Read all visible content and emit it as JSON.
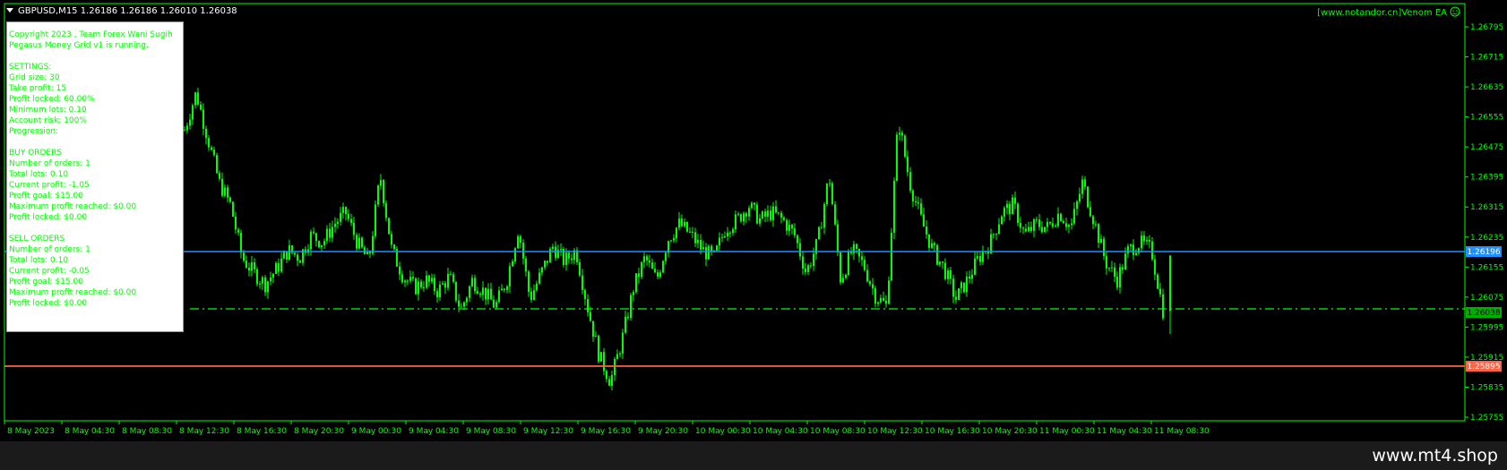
{
  "header": {
    "symbol_line": "GBPUSD,M15  1.26186 1.26186 1.26010 1.26038",
    "ea_label": "[www.notandor.cn]Venom EA",
    "ea_icon": "smiley-icon"
  },
  "info_panel": {
    "lines": [
      "Copyright 2023 , Team Forex Wani Sugih",
      "Pegasus Money Grid v1 is running.",
      "",
      "SETTINGS:",
      "Grid size: 30",
      "Take profit: 15",
      "Profit locked: 60.00%",
      "Minimum lots: 0.10",
      "Account risk: 100%",
      "Progression:",
      "",
      "BUY ORDERS",
      "Number of orders: 1",
      "Total lots: 0.10",
      "Current profit: -1.05",
      "Profit goal: $15.00",
      "Maximum profit reached: $0.00",
      "Profit locked: $0.00",
      "",
      "SELL ORDERS",
      "Number of orders: 1",
      "Total lots: 0.10",
      "Current profit: -0.05",
      "Profit goal: $15.00",
      "Maximum profit reached: $0.00",
      "Profit locked: $0.00"
    ]
  },
  "price_axis": {
    "ticks": [
      "1.26795",
      "1.26715",
      "1.26635",
      "1.26555",
      "1.26475",
      "1.26395",
      "1.26315",
      "1.26235",
      "1.26155",
      "1.26075",
      "1.25995",
      "1.25915",
      "1.25835",
      "1.25755"
    ]
  },
  "time_axis": {
    "labels": [
      "8 May 2023",
      "8 May 04:30",
      "8 May 08:30",
      "8 May 12:30",
      "8 May 16:30",
      "8 May 20:30",
      "9 May 00:30",
      "9 May 04:30",
      "9 May 08:30",
      "9 May 12:30",
      "9 May 16:30",
      "9 May 20:30",
      "10 May 00:30",
      "10 May 04:30",
      "10 May 08:30",
      "10 May 12:30",
      "10 May 16:30",
      "10 May 20:30",
      "11 May 00:30",
      "11 May 04:30",
      "11 May 08:30"
    ]
  },
  "levels": {
    "blue": {
      "price": "1.26196",
      "color": "#1e90ff"
    },
    "current": {
      "price": "1.26038",
      "color": "#00ff00"
    },
    "red": {
      "price": "1.25895",
      "color": "#ff6347"
    }
  },
  "colors": {
    "candles": "#00ff00",
    "grid_frame": "#00ff00",
    "background": "#000000"
  },
  "chart_data": {
    "type": "line",
    "x": [
      "8 May 2023",
      "8 May 04:30",
      "8 May 08:30",
      "8 May 12:30",
      "8 May 16:30",
      "8 May 20:30",
      "9 May 00:30",
      "9 May 04:30",
      "9 May 08:30",
      "9 May 12:30",
      "9 May 16:30",
      "9 May 20:30",
      "10 May 00:30",
      "10 May 04:30",
      "10 May 08:30",
      "10 May 12:30",
      "10 May 16:30",
      "10 May 20:30",
      "11 May 00:30",
      "11 May 04:30",
      "11 May 08:30"
    ],
    "series": [
      {
        "name": "GBPUSD,M15",
        "values": [
          1.2652,
          1.2662,
          1.265,
          1.2638,
          1.2632,
          1.2618,
          1.2614,
          1.2611,
          1.2615,
          1.262,
          1.2618,
          1.2624,
          1.2622,
          1.2627,
          1.263,
          1.2622,
          1.2617,
          1.264,
          1.262,
          1.2613,
          1.261,
          1.2612,
          1.2609,
          1.2613,
          1.2604,
          1.2612,
          1.2609,
          1.2605,
          1.2612,
          1.2626,
          1.2607,
          1.2614,
          1.2621,
          1.2617,
          1.262,
          1.2605,
          1.2592,
          1.2585,
          1.2596,
          1.261,
          1.2618,
          1.2612,
          1.2623,
          1.2627,
          1.2624,
          1.262,
          1.2618,
          1.2626,
          1.2628,
          1.2632,
          1.2628,
          1.263,
          1.2628,
          1.2624,
          1.2614,
          1.2622,
          1.264,
          1.2612,
          1.262,
          1.2616,
          1.2608,
          1.2605,
          1.2655,
          1.2638,
          1.2628,
          1.262,
          1.2615,
          1.2607,
          1.2612,
          1.2618,
          1.2622,
          1.263,
          1.2632,
          1.2624,
          1.2627,
          1.2626,
          1.263,
          1.2626,
          1.2638,
          1.2628,
          1.2617,
          1.2612,
          1.262,
          1.2622,
          1.262,
          1.2604
        ]
      }
    ],
    "ylim": [
      1.2572,
      1.2683
    ],
    "last_bar": {
      "open": 1.26186,
      "high": 1.26186,
      "low": 1.2601,
      "close": 1.26038
    }
  }
}
